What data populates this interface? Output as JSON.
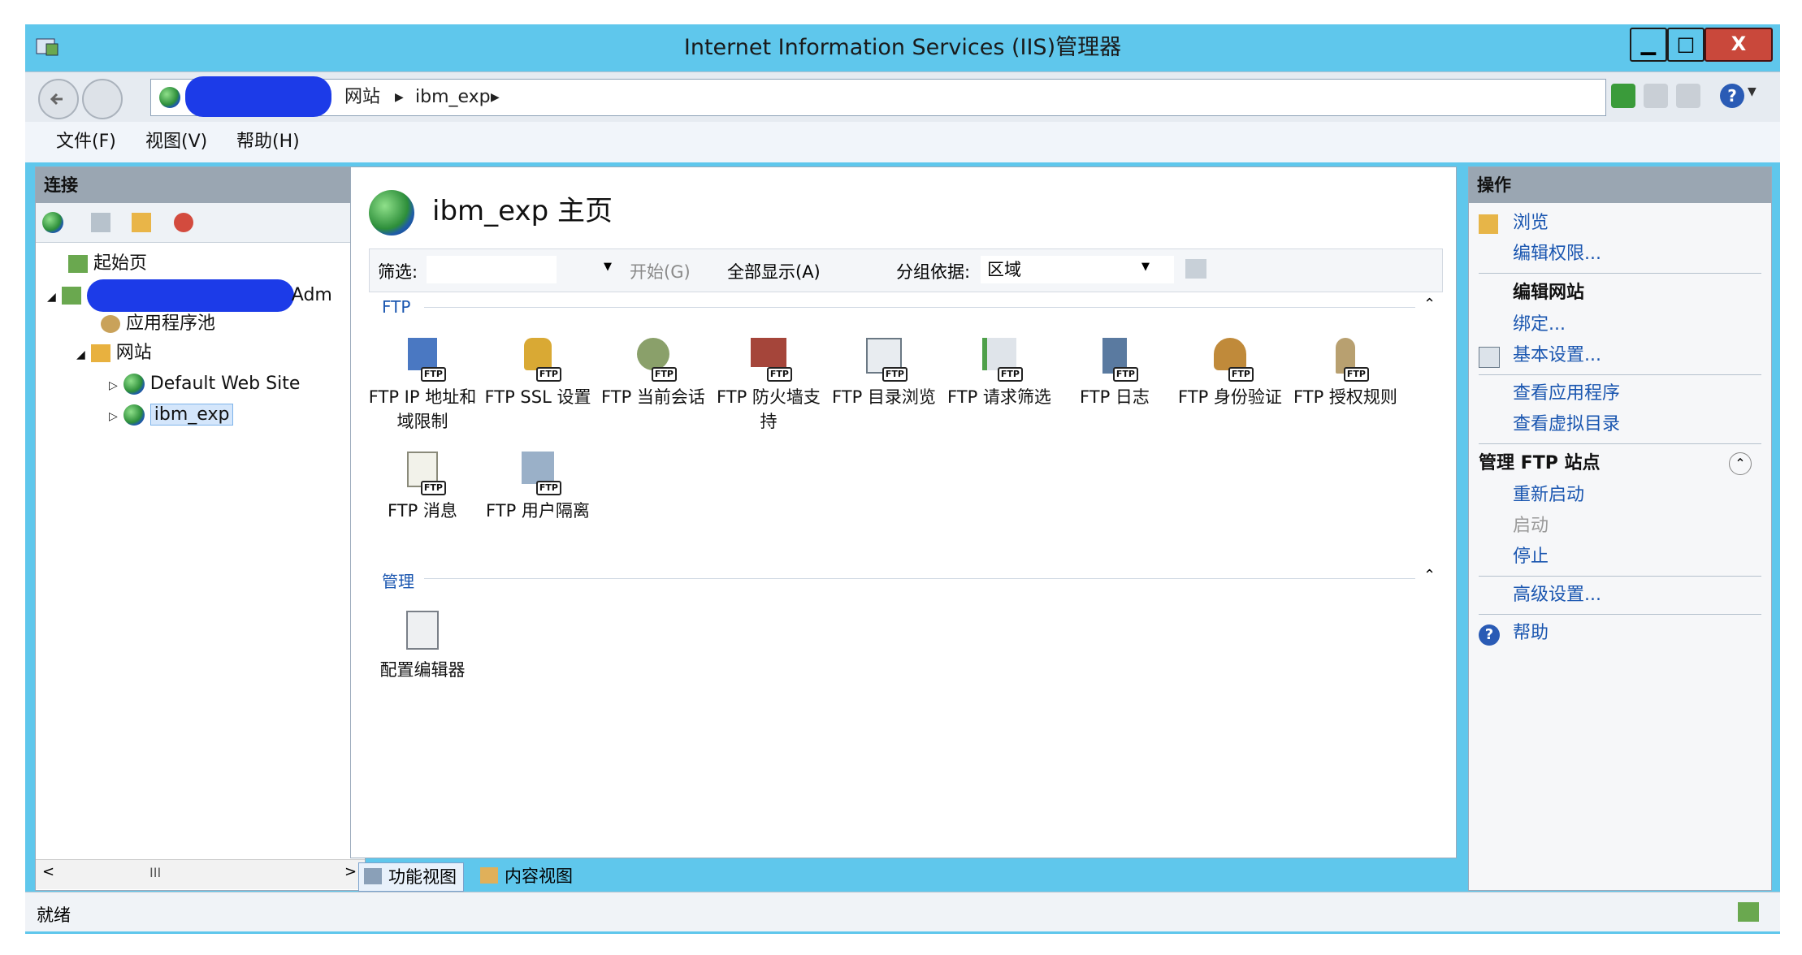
{
  "window": {
    "title": "Internet Information Services (IIS)管理器",
    "controls": [
      "▁",
      "□",
      "X"
    ]
  },
  "address": {
    "crumbs": [
      "网站",
      "ibm_exp"
    ]
  },
  "menu": [
    "文件(F)",
    "视图(V)",
    "帮助(H)"
  ],
  "left_pane": {
    "header": "连接",
    "tree": {
      "start_page": "起始页",
      "server_suffix": "Adm",
      "app_pools": "应用程序池",
      "sites": "网站",
      "site1": "Default Web Site",
      "site2": "ibm_exp"
    },
    "scroll_mid": "III"
  },
  "center": {
    "title": "ibm_exp 主页",
    "filter_label": "筛选:",
    "start_btn": "开始(G)",
    "show_all": "全部显示(A)",
    "group_by_label": "分组依据:",
    "group_by_value": "区域",
    "groups": [
      {
        "name": "FTP",
        "features": [
          {
            "label": "FTP IP 地址和域限制",
            "icon": "ip-restrict-icon"
          },
          {
            "label": "FTP SSL 设置",
            "icon": "lock-icon"
          },
          {
            "label": "FTP 当前会话",
            "icon": "users-icon"
          },
          {
            "label": "FTP 防火墙支持",
            "icon": "firewall-icon"
          },
          {
            "label": "FTP 目录浏览",
            "icon": "directory-icon"
          },
          {
            "label": "FTP 请求筛选",
            "icon": "filter-icon"
          },
          {
            "label": "FTP 日志",
            "icon": "log-icon"
          },
          {
            "label": "FTP 身份验证",
            "icon": "auth-icon"
          },
          {
            "label": "FTP 授权规则",
            "icon": "key-icon"
          },
          {
            "label": "FTP 消息",
            "icon": "message-icon"
          },
          {
            "label": "FTP 用户隔离",
            "icon": "isolation-icon"
          }
        ]
      },
      {
        "name": "管理",
        "features": [
          {
            "label": "配置编辑器",
            "icon": "config-editor-icon"
          }
        ]
      }
    ],
    "tabs": [
      "功能视图",
      "内容视图"
    ],
    "ftp_tag": "FTP"
  },
  "right_pane": {
    "header": "操作",
    "browse": "浏览",
    "edit_perms": "编辑权限...",
    "edit_site_header": "编辑网站",
    "bindings": "绑定...",
    "basic_settings": "基本设置...",
    "view_apps": "查看应用程序",
    "view_vdirs": "查看虚拟目录",
    "manage_ftp_header": "管理 FTP 站点",
    "restart": "重新启动",
    "start": "启动",
    "stop": "停止",
    "advanced": "高级设置...",
    "help": "帮助"
  },
  "status": {
    "text": "就绪"
  }
}
